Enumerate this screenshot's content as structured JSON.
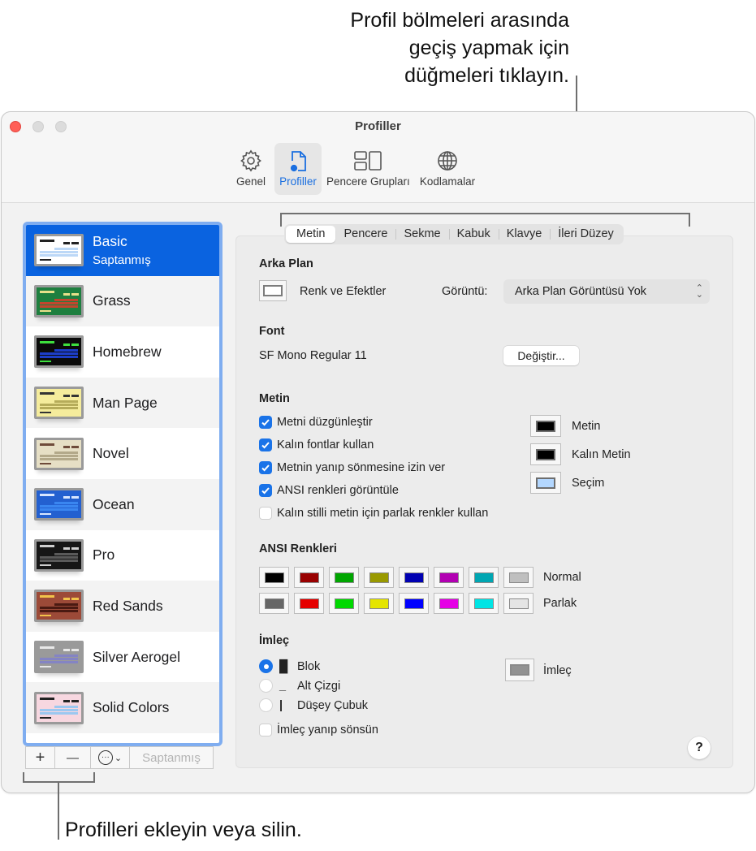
{
  "callouts": {
    "top_line1": "Profil bölmeleri arasında",
    "top_line2": "geçiş yapmak için",
    "top_line3": "düğmeleri tıklayın.",
    "bottom": "Profilleri ekleyin veya silin."
  },
  "window": {
    "title": "Profiller",
    "toolbar": [
      {
        "icon": "gear-icon",
        "label": "Genel",
        "active": false
      },
      {
        "icon": "profile-document-icon",
        "label": "Profiller",
        "active": true
      },
      {
        "icon": "window-groups-icon",
        "label": "Pencere Grupları",
        "active": false
      },
      {
        "icon": "globe-icon",
        "label": "Kodlamalar",
        "active": false
      }
    ]
  },
  "sidebar": {
    "profiles": [
      {
        "name": "Basic",
        "subtitle": "Saptanmış",
        "selected": true,
        "bg": "#ffffff",
        "row": "#bcd8f7",
        "hdr": "#222222"
      },
      {
        "name": "Grass",
        "selected": false,
        "bg": "#1e7f3f",
        "row": "#c2462e",
        "hdr": "#e8e08a"
      },
      {
        "name": "Homebrew",
        "selected": false,
        "bg": "#0b0b0b",
        "row": "#1d3ec8",
        "hdr": "#3ee03e"
      },
      {
        "name": "Man Page",
        "selected": false,
        "bg": "#f5ec9c",
        "row": "#b6ac5a",
        "hdr": "#333333"
      },
      {
        "name": "Novel",
        "selected": false,
        "bg": "#e6dfc5",
        "row": "#b3a98a",
        "hdr": "#6e4b3a"
      },
      {
        "name": "Ocean",
        "selected": false,
        "bg": "#2360d0",
        "row": "#3a86f0",
        "hdr": "#d8e6ff"
      },
      {
        "name": "Pro",
        "selected": false,
        "bg": "#161616",
        "row": "#5a5a5a",
        "hdr": "#cfcfcf"
      },
      {
        "name": "Red Sands",
        "selected": false,
        "bg": "#9c4a38",
        "row": "#4a1a12",
        "hdr": "#f2c34a"
      },
      {
        "name": "Silver Aerogel",
        "selected": false,
        "bg": "#9a9a9a",
        "row": "#8484c4",
        "hdr": "#e8e8e8"
      },
      {
        "name": "Solid Colors",
        "selected": false,
        "bg": "#f7d7e0",
        "row": "#9cc8f0",
        "hdr": "#222222"
      }
    ],
    "buttons": {
      "add": "+",
      "remove": "—",
      "more": "⊙⌄",
      "default": "Saptanmış"
    }
  },
  "tabs": [
    {
      "label": "Metin",
      "active": true
    },
    {
      "label": "Pencere",
      "active": false
    },
    {
      "label": "Sekme",
      "active": false
    },
    {
      "label": "Kabuk",
      "active": false
    },
    {
      "label": "Klavye",
      "active": false
    },
    {
      "label": "İleri Düzey",
      "active": false
    }
  ],
  "background": {
    "title": "Arka Plan",
    "color_effects_label": "Renk ve Efektler",
    "image_label": "Görüntü:",
    "image_value": "Arka Plan Görüntüsü Yok"
  },
  "font": {
    "title": "Font",
    "value": "SF Mono Regular 11",
    "change_button": "Değiştir..."
  },
  "text": {
    "title": "Metin",
    "checkboxes": [
      {
        "label": "Metni düzgünleştir",
        "checked": true
      },
      {
        "label": "Kalın fontlar kullan",
        "checked": true
      },
      {
        "label": "Metnin yanıp sönmesine izin ver",
        "checked": true
      },
      {
        "label": "ANSI renkleri görüntüle",
        "checked": true
      },
      {
        "label": "Kalın stilli metin için parlak renkler kullan",
        "checked": false
      }
    ],
    "colors": [
      {
        "label": "Metin",
        "color": "#000000"
      },
      {
        "label": "Kalın Metin",
        "color": "#000000"
      },
      {
        "label": "Seçim",
        "color": "#b3d7ff"
      }
    ]
  },
  "ansi": {
    "title": "ANSI Renkleri",
    "normal_label": "Normal",
    "bright_label": "Parlak",
    "normal": [
      "#000000",
      "#990000",
      "#00a600",
      "#999900",
      "#0000b2",
      "#b200b2",
      "#00a6b2",
      "#bfbfbf"
    ],
    "bright": [
      "#666666",
      "#e50000",
      "#00d900",
      "#e5e500",
      "#0000ff",
      "#e500e5",
      "#00e5e5",
      "#e5e5e5"
    ]
  },
  "cursor": {
    "title": "İmleç",
    "options": [
      {
        "glyph": "█",
        "label": "Blok",
        "selected": true
      },
      {
        "glyph": "_",
        "label": "Alt Çizgi",
        "selected": false
      },
      {
        "glyph": "|",
        "label": "Düşey Çubuk",
        "selected": false
      }
    ],
    "blink_label": "İmleç yanıp sönsün",
    "blink_checked": false,
    "color_label": "İmleç",
    "color": "#929292"
  },
  "help_label": "?"
}
